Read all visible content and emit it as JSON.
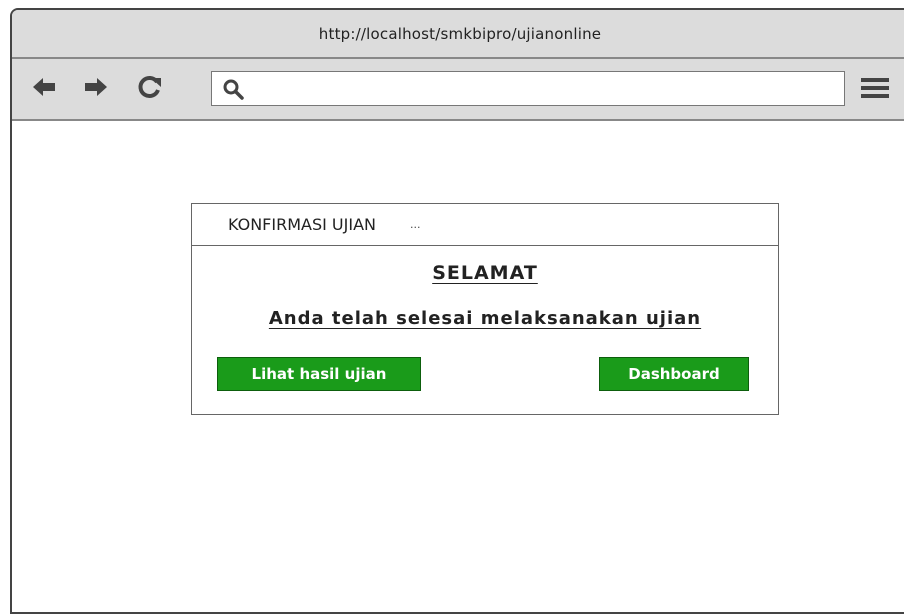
{
  "browser": {
    "url": "http://localhost/smkbipro/ujianonline",
    "address_value": ""
  },
  "icons": {
    "back": "arrow-left-icon",
    "forward": "arrow-right-icon",
    "reload": "reload-icon",
    "search": "search-icon",
    "menu": "hamburger-menu-icon"
  },
  "panel": {
    "title": "KONFIRMASI UJIAN",
    "title_dots": "...",
    "heading": "SELAMAT",
    "message": "Anda telah selesai melaksanakan ujian",
    "buttons": {
      "hasil": "Lihat hasil ujian",
      "dashboard": "Dashboard"
    }
  },
  "colors": {
    "button_green": "#1a9b1a",
    "chrome_gray": "#dcdcdc"
  }
}
